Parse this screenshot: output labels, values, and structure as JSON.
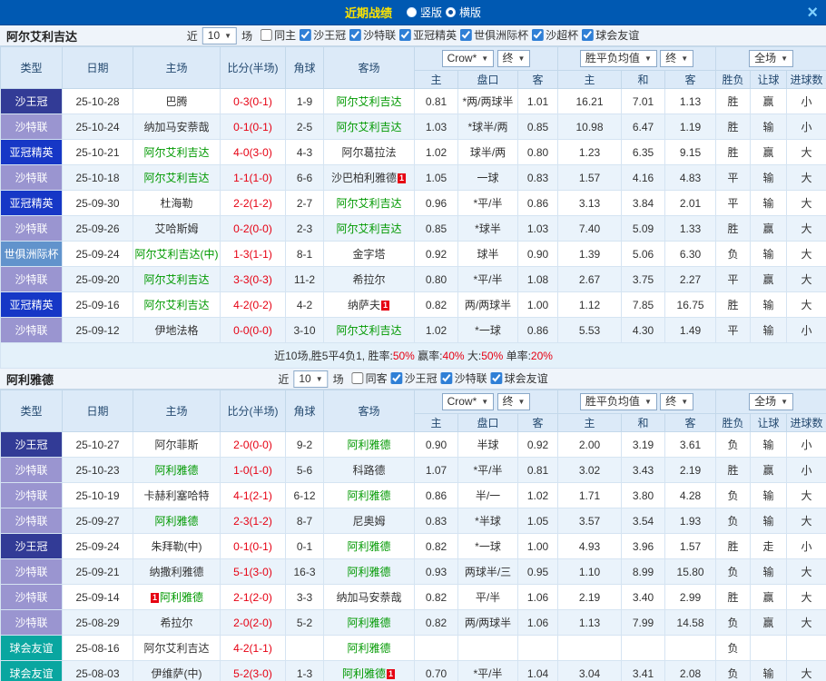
{
  "topbar": {
    "title": "近期战绩",
    "radios": [
      {
        "label": "竖版",
        "selected": false
      },
      {
        "label": "横版",
        "selected": true
      }
    ],
    "close": "×"
  },
  "table_header": {
    "col_type": "类型",
    "col_date": "日期",
    "col_home": "主场",
    "col_score": "比分(半场)",
    "col_corner": "角球",
    "col_away": "客场",
    "dd_bookmaker": "Crow*",
    "dd_final": "终",
    "dd_avg": "胜平负均值",
    "dd_scope": "全场",
    "sub_home": "主",
    "sub_handicap": "盘口",
    "sub_away": "客",
    "sub_draw": "和",
    "col_wl": "胜负",
    "col_let": "让球",
    "col_goals": "进球数"
  },
  "league_colors": {
    "沙王冠": "#323B96",
    "沙特联": "#9A95D0",
    "亚冠精英": "#1637C6",
    "世俱洲际杯": "#6193CC",
    "球会友谊": "#09A6A0"
  },
  "sections": [
    {
      "team": "阿尔艾利吉达",
      "near_label": "近",
      "near_value": "10",
      "unit_label": "场",
      "filters": [
        {
          "label": "同主",
          "checked": false
        },
        {
          "label": "沙王冠",
          "checked": true
        },
        {
          "label": "沙特联",
          "checked": true
        },
        {
          "label": "亚冠精英",
          "checked": true
        },
        {
          "label": "世俱洲际杯",
          "checked": true
        },
        {
          "label": "沙超杯",
          "checked": true
        },
        {
          "label": "球会友谊",
          "checked": true
        }
      ],
      "rows": [
        {
          "type": "沙王冠",
          "date": "25-10-28",
          "home": "巴腾",
          "home_green": false,
          "score": "0-3(0-1)",
          "corner": "1-9",
          "away": "阿尔艾利吉达",
          "away_green": true,
          "oh": "0.81",
          "pan": "*两/两球半",
          "oa": "1.01",
          "ah": "16.21",
          "ad": "7.01",
          "aa": "1.13",
          "wl": "胜",
          "wl_c": "red",
          "let": "赢",
          "let_c": "red",
          "big": "小",
          "big_c": "green"
        },
        {
          "type": "沙特联",
          "date": "25-10-24",
          "home": "纳加马安萘哉",
          "home_green": false,
          "score": "0-1(0-1)",
          "corner": "2-5",
          "away": "阿尔艾利吉达",
          "away_green": true,
          "oh": "1.03",
          "pan": "*球半/两",
          "oa": "0.85",
          "ah": "10.98",
          "ad": "6.47",
          "aa": "1.19",
          "wl": "胜",
          "wl_c": "red",
          "let": "输",
          "let_c": "green",
          "big": "小",
          "big_c": "green"
        },
        {
          "type": "亚冠精英",
          "date": "25-10-21",
          "home": "阿尔艾利吉达",
          "home_green": true,
          "score": "4-0(3-0)",
          "corner": "4-3",
          "away": "阿尔葛拉法",
          "away_green": false,
          "oh": "1.02",
          "pan": "球半/两",
          "oa": "0.80",
          "ah": "1.23",
          "ad": "6.35",
          "aa": "9.15",
          "wl": "胜",
          "wl_c": "red",
          "let": "赢",
          "let_c": "red",
          "big": "大",
          "big_c": "red"
        },
        {
          "type": "沙特联",
          "date": "25-10-18",
          "home": "阿尔艾利吉达",
          "home_green": true,
          "score": "1-1(1-0)",
          "corner": "6-6",
          "away": "沙巴柏利雅德",
          "away_green": false,
          "away_badge": "1",
          "away_badge_pos": "after",
          "oh": "1.05",
          "pan": "一球",
          "oa": "0.83",
          "ah": "1.57",
          "ad": "4.16",
          "aa": "4.83",
          "wl": "平",
          "wl_c": "blue",
          "let": "输",
          "let_c": "green",
          "big": "大",
          "big_c": "red"
        },
        {
          "type": "亚冠精英",
          "date": "25-09-30",
          "home": "杜海勒",
          "home_green": false,
          "score": "2-2(1-2)",
          "corner": "2-7",
          "away": "阿尔艾利吉达",
          "away_green": true,
          "oh": "0.96",
          "pan": "*平/半",
          "oa": "0.86",
          "ah": "3.13",
          "ad": "3.84",
          "aa": "2.01",
          "wl": "平",
          "wl_c": "blue",
          "let": "输",
          "let_c": "green",
          "big": "大",
          "big_c": "red"
        },
        {
          "type": "沙特联",
          "date": "25-09-26",
          "home": "艾哈斯姆",
          "home_green": false,
          "score": "0-2(0-0)",
          "corner": "2-3",
          "away": "阿尔艾利吉达",
          "away_green": true,
          "oh": "0.85",
          "pan": "*球半",
          "oa": "1.03",
          "ah": "7.40",
          "ad": "5.09",
          "aa": "1.33",
          "wl": "胜",
          "wl_c": "red",
          "let": "赢",
          "let_c": "red",
          "big": "大",
          "big_c": "red"
        },
        {
          "type": "世俱洲际杯",
          "date": "25-09-24",
          "home": "阿尔艾利吉达(中)",
          "home_green": true,
          "score": "1-3(1-1)",
          "corner": "8-1",
          "away": "金字塔",
          "away_green": false,
          "oh": "0.92",
          "pan": "球半",
          "oa": "0.90",
          "ah": "1.39",
          "ad": "5.06",
          "aa": "6.30",
          "wl": "负",
          "wl_c": "green",
          "let": "输",
          "let_c": "green",
          "big": "大",
          "big_c": "red"
        },
        {
          "type": "沙特联",
          "date": "25-09-20",
          "home": "阿尔艾利吉达",
          "home_green": true,
          "score": "3-3(0-3)",
          "corner": "11-2",
          "away": "希拉尔",
          "away_green": false,
          "oh": "0.80",
          "pan": "*平/半",
          "oa": "1.08",
          "ah": "2.67",
          "ad": "3.75",
          "aa": "2.27",
          "wl": "平",
          "wl_c": "blue",
          "let": "赢",
          "let_c": "red",
          "big": "大",
          "big_c": "red"
        },
        {
          "type": "亚冠精英",
          "date": "25-09-16",
          "home": "阿尔艾利吉达",
          "home_green": true,
          "score": "4-2(0-2)",
          "corner": "4-2",
          "away": "纳萨夫",
          "away_green": false,
          "away_badge": "1",
          "away_badge_pos": "after",
          "oh": "0.82",
          "pan": "两/两球半",
          "oa": "1.00",
          "ah": "1.12",
          "ad": "7.85",
          "aa": "16.75",
          "wl": "胜",
          "wl_c": "red",
          "let": "输",
          "let_c": "green",
          "big": "大",
          "big_c": "red"
        },
        {
          "type": "沙特联",
          "date": "25-09-12",
          "home": "伊地法格",
          "home_green": false,
          "score": "0-0(0-0)",
          "corner": "3-10",
          "away": "阿尔艾利吉达",
          "away_green": true,
          "oh": "1.02",
          "pan": "*一球",
          "oa": "0.86",
          "ah": "5.53",
          "ad": "4.30",
          "aa": "1.49",
          "wl": "平",
          "wl_c": "blue",
          "let": "输",
          "let_c": "green",
          "big": "小",
          "big_c": "green"
        }
      ],
      "summary": [
        {
          "text": "近10场,胜5平4负1, ",
          "cls": "plain"
        },
        {
          "text": "胜率:",
          "cls": "plain"
        },
        {
          "text": "50%",
          "cls": "red"
        },
        {
          "text": " 赢率:",
          "cls": "plain"
        },
        {
          "text": "40%",
          "cls": "red"
        },
        {
          "text": " 大:",
          "cls": "plain"
        },
        {
          "text": "50%",
          "cls": "red"
        },
        {
          "text": " 单率:",
          "cls": "plain"
        },
        {
          "text": "20%",
          "cls": "red"
        }
      ]
    },
    {
      "team": "阿利雅德",
      "near_label": "近",
      "near_value": "10",
      "unit_label": "场",
      "filters": [
        {
          "label": "同客",
          "checked": false
        },
        {
          "label": "沙王冠",
          "checked": true
        },
        {
          "label": "沙特联",
          "checked": true
        },
        {
          "label": "球会友谊",
          "checked": true
        }
      ],
      "rows": [
        {
          "type": "沙王冠",
          "date": "25-10-27",
          "home": "阿尔菲斯",
          "home_green": false,
          "score": "2-0(0-0)",
          "corner": "9-2",
          "away": "阿利雅德",
          "away_green": true,
          "oh": "0.90",
          "pan": "半球",
          "oa": "0.92",
          "ah": "2.00",
          "ad": "3.19",
          "aa": "3.61",
          "wl": "负",
          "wl_c": "green",
          "let": "输",
          "let_c": "green",
          "big": "小",
          "big_c": "green"
        },
        {
          "type": "沙特联",
          "date": "25-10-23",
          "home": "阿利雅德",
          "home_green": true,
          "score": "1-0(1-0)",
          "corner": "5-6",
          "away": "科路德",
          "away_green": false,
          "oh": "1.07",
          "pan": "*平/半",
          "oa": "0.81",
          "ah": "3.02",
          "ad": "3.43",
          "aa": "2.19",
          "wl": "胜",
          "wl_c": "red",
          "let": "赢",
          "let_c": "red",
          "big": "小",
          "big_c": "green"
        },
        {
          "type": "沙特联",
          "date": "25-10-19",
          "home": "卡赫利塞哈特",
          "home_green": false,
          "score": "4-1(2-1)",
          "corner": "6-12",
          "away": "阿利雅德",
          "away_green": true,
          "oh": "0.86",
          "pan": "半/一",
          "oa": "1.02",
          "ah": "1.71",
          "ad": "3.80",
          "aa": "4.28",
          "wl": "负",
          "wl_c": "green",
          "let": "输",
          "let_c": "green",
          "big": "大",
          "big_c": "red"
        },
        {
          "type": "沙特联",
          "date": "25-09-27",
          "home": "阿利雅德",
          "home_green": true,
          "score": "2-3(1-2)",
          "corner": "8-7",
          "away": "尼奥姆",
          "away_green": false,
          "oh": "0.83",
          "pan": "*半球",
          "oa": "1.05",
          "ah": "3.57",
          "ad": "3.54",
          "aa": "1.93",
          "wl": "负",
          "wl_c": "green",
          "let": "输",
          "let_c": "green",
          "big": "大",
          "big_c": "red"
        },
        {
          "type": "沙王冠",
          "date": "25-09-24",
          "home": "朱拜勒(中)",
          "home_green": false,
          "score": "0-1(0-1)",
          "corner": "0-1",
          "away": "阿利雅德",
          "away_green": true,
          "oh": "0.82",
          "pan": "*一球",
          "oa": "1.00",
          "ah": "4.93",
          "ad": "3.96",
          "aa": "1.57",
          "wl": "胜",
          "wl_c": "red",
          "let": "走",
          "let_c": "blue",
          "big": "小",
          "big_c": "green"
        },
        {
          "type": "沙特联",
          "date": "25-09-21",
          "home": "纳撒利雅德",
          "home_green": false,
          "score": "5-1(3-0)",
          "corner": "16-3",
          "away": "阿利雅德",
          "away_green": true,
          "oh": "0.93",
          "pan": "两球半/三",
          "oa": "0.95",
          "ah": "1.10",
          "ad": "8.99",
          "aa": "15.80",
          "wl": "负",
          "wl_c": "green",
          "let": "输",
          "let_c": "green",
          "big": "大",
          "big_c": "red"
        },
        {
          "type": "沙特联",
          "date": "25-09-14",
          "home": "阿利雅德",
          "home_green": true,
          "home_badge": "1",
          "home_badge_pos": "before",
          "score": "2-1(2-0)",
          "corner": "3-3",
          "away": "纳加马安萘哉",
          "away_green": false,
          "oh": "0.82",
          "pan": "平/半",
          "oa": "1.06",
          "ah": "2.19",
          "ad": "3.40",
          "aa": "2.99",
          "wl": "胜",
          "wl_c": "red",
          "let": "赢",
          "let_c": "red",
          "big": "大",
          "big_c": "red"
        },
        {
          "type": "沙特联",
          "date": "25-08-29",
          "home": "希拉尔",
          "home_green": false,
          "score": "2-0(2-0)",
          "corner": "5-2",
          "away": "阿利雅德",
          "away_green": true,
          "oh": "0.82",
          "pan": "两/两球半",
          "oa": "1.06",
          "ah": "1.13",
          "ad": "7.99",
          "aa": "14.58",
          "wl": "负",
          "wl_c": "green",
          "let": "赢",
          "let_c": "red",
          "big": "大",
          "big_c": "red"
        },
        {
          "type": "球会友谊",
          "date": "25-08-16",
          "home": "阿尔艾利吉达",
          "home_green": false,
          "score": "4-2(1-1)",
          "corner": "",
          "away": "阿利雅德",
          "away_green": true,
          "oh": "",
          "pan": "",
          "oa": "",
          "ah": "",
          "ad": "",
          "aa": "",
          "wl": "负",
          "wl_c": "green",
          "let": "",
          "let_c": "plain",
          "big": "",
          "big_c": "plain"
        },
        {
          "type": "球会友谊",
          "date": "25-08-03",
          "home": "伊维萨(中)",
          "home_green": false,
          "score": "5-2(3-0)",
          "corner": "1-3",
          "away": "阿利雅德",
          "away_green": true,
          "away_badge": "1",
          "away_badge_pos": "after",
          "oh": "0.70",
          "pan": "*平/半",
          "oa": "1.04",
          "ah": "3.04",
          "ad": "3.41",
          "aa": "2.08",
          "wl": "负",
          "wl_c": "green",
          "let": "输",
          "let_c": "green",
          "big": "大",
          "big_c": "red"
        }
      ]
    }
  ]
}
